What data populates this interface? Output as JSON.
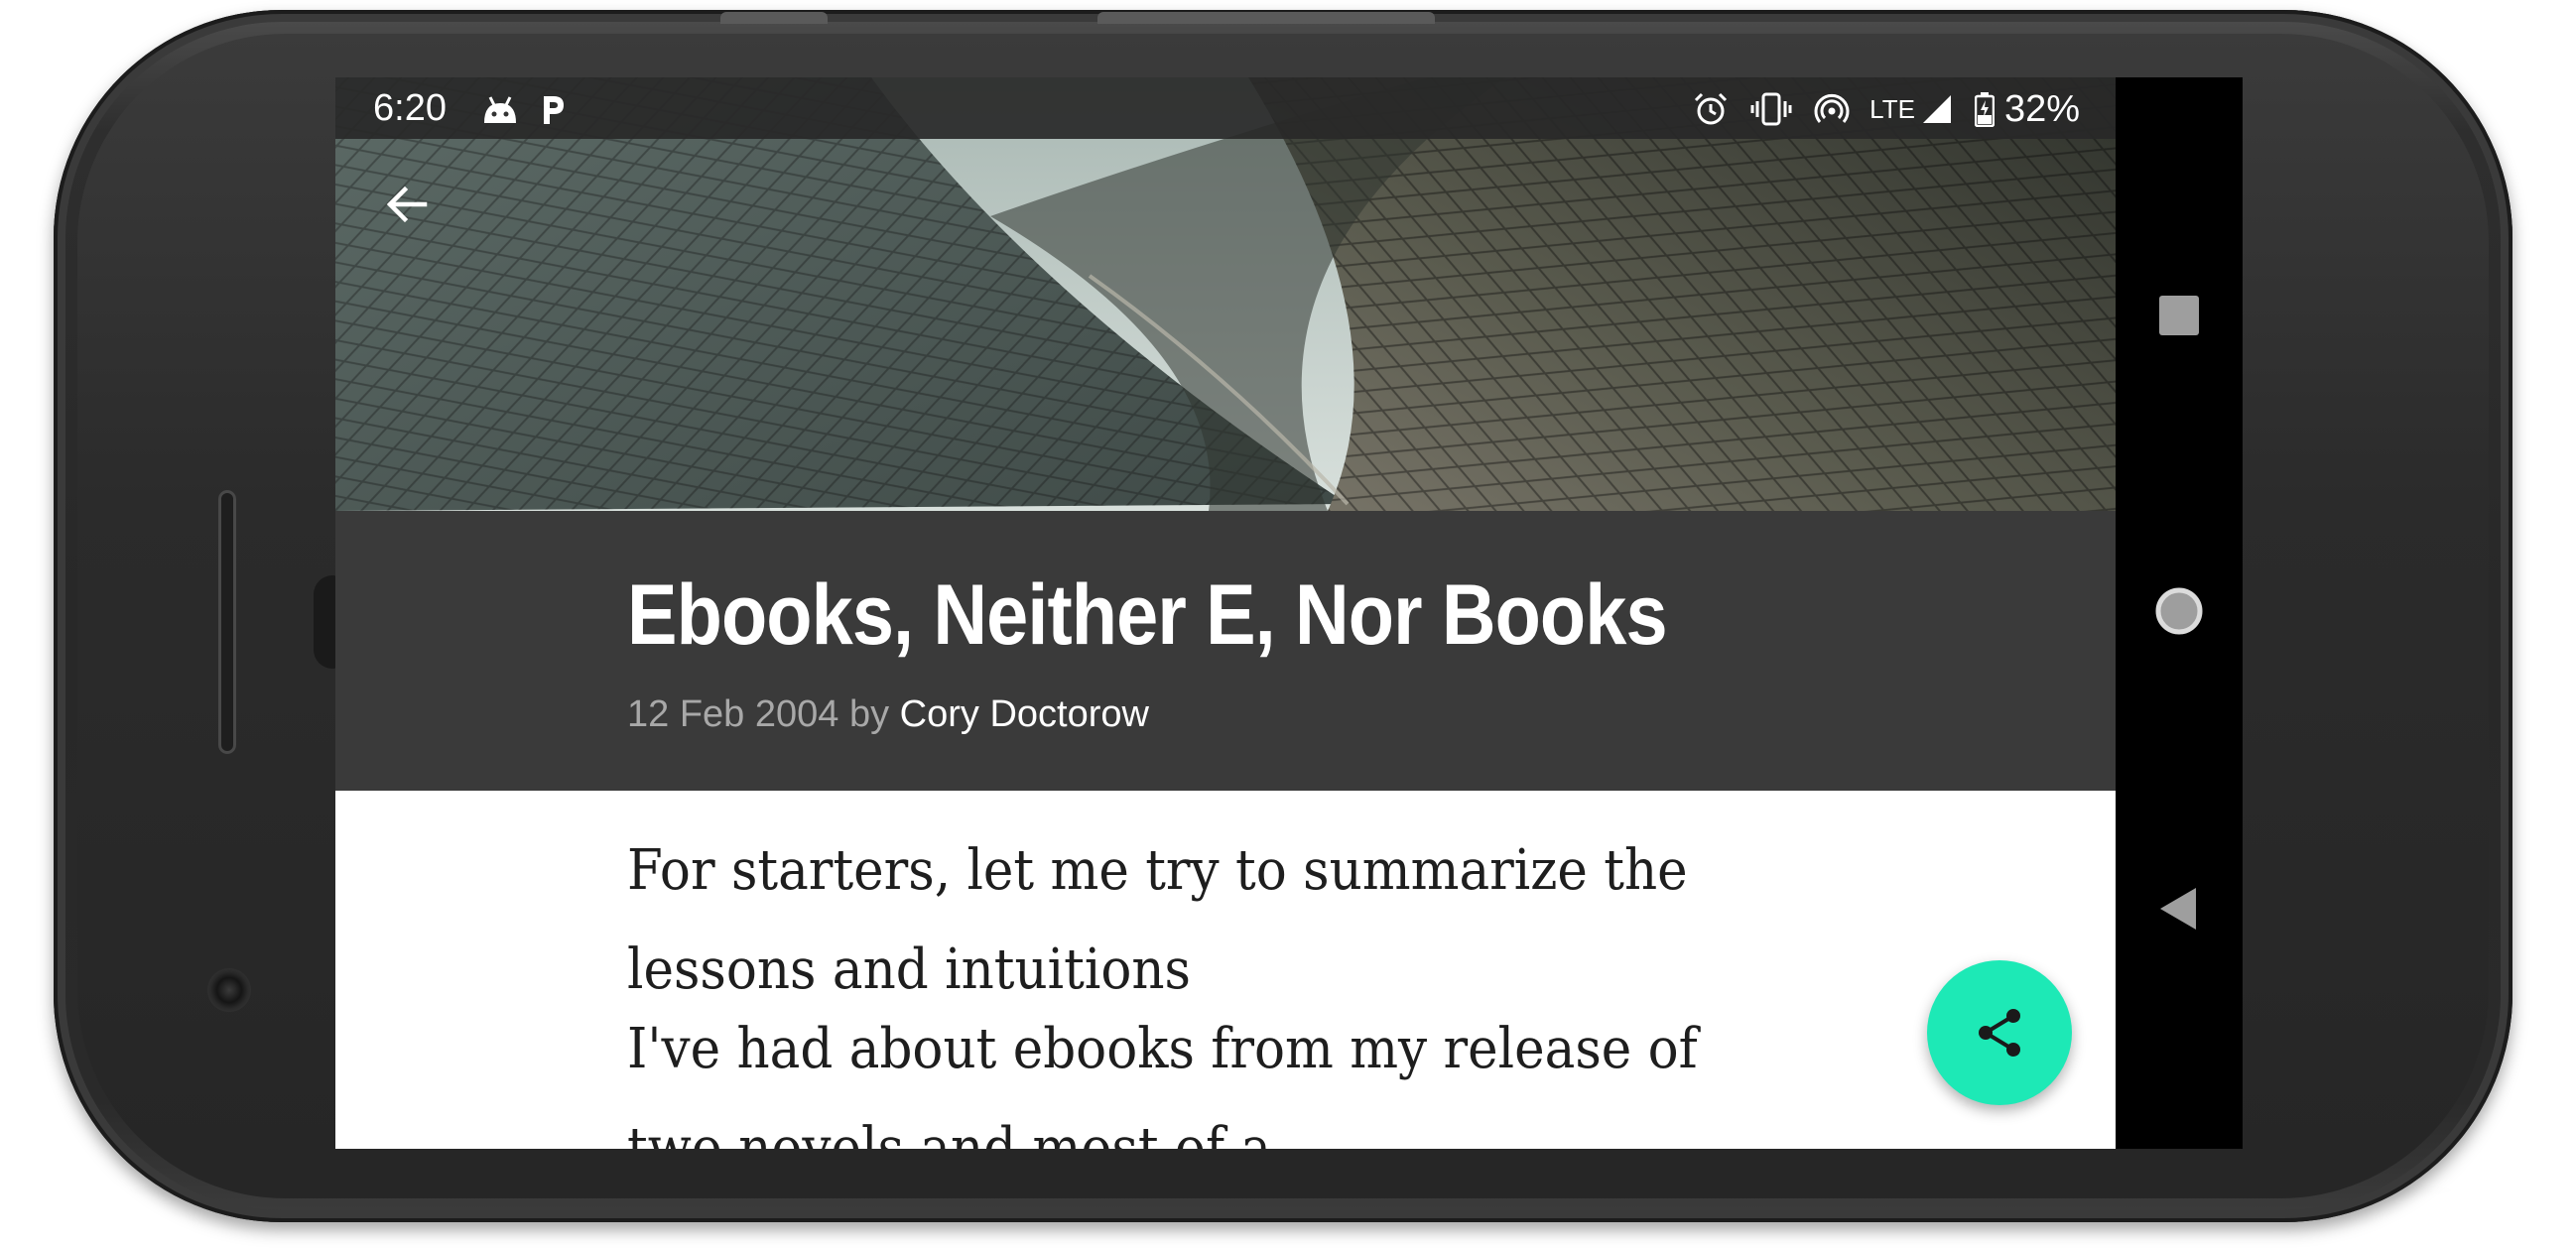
{
  "status_bar": {
    "time": "6:20",
    "left_icons": [
      "android-icon",
      "p-icon"
    ],
    "right_icons": [
      "alarm-icon",
      "vibrate-icon",
      "hotspot-icon",
      "signal-icon",
      "battery-icon"
    ],
    "network": "LTE",
    "battery": "32%"
  },
  "toolbar": {
    "back_icon": "arrow-back-icon"
  },
  "article": {
    "title": "Ebooks, Neither E, Nor Books",
    "date": "12 Feb 2004",
    "by": "by",
    "author": "Cory Doctorow",
    "body_lines": [
      "For starters, let me try to summarize the",
      "lessons and intuitions",
      "I've had about ebooks from my release of",
      "two novels and most of a"
    ]
  },
  "fab": {
    "icon": "share-icon",
    "color": "#1de9b6"
  },
  "navigation": {
    "recents_icon": "square-icon",
    "home_icon": "circle-icon",
    "back_icon": "triangle-back-icon"
  },
  "colors": {
    "title_block": "#3a3a3a",
    "accent": "#1de9b6",
    "body_text": "#1e1e1e"
  }
}
